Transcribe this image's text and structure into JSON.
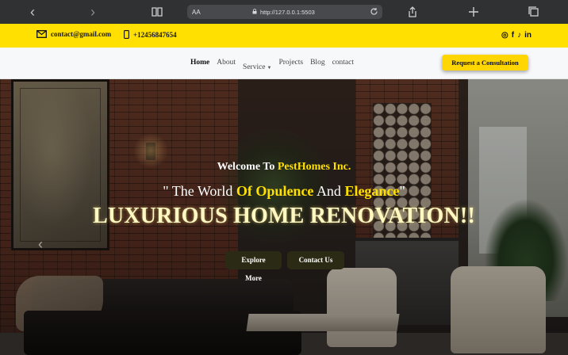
{
  "browser": {
    "url": "http://127.0.0.1:5503",
    "text_size_label": "AA"
  },
  "topbar": {
    "email": "contact@gmail.com",
    "phone": "+12456847654",
    "social_icons": [
      "instagram-icon",
      "facebook-icon",
      "tiktok-icon",
      "linkedin-icon"
    ],
    "social_glyphs": [
      "◎",
      "f",
      "♪",
      "in"
    ]
  },
  "nav": {
    "items": [
      {
        "label": "Home",
        "active": true
      },
      {
        "label": "About"
      },
      {
        "label": "Service",
        "dropdown": true
      },
      {
        "label": "Projects"
      },
      {
        "label": "Blog"
      },
      {
        "label": "contact"
      }
    ],
    "cta": "Request a Consultation"
  },
  "hero": {
    "welcome_prefix": "Welcome To",
    "brand": "PestHomes Inc.",
    "quote_open": "\" The World",
    "quote_hl1": "Of Opulence",
    "quote_mid": "And",
    "quote_hl2": "Elegance",
    "quote_close": "\"",
    "title": "LUXURIOUS HOME RENOVATION!!",
    "primary_button": "Explore More",
    "secondary_button": "Contact Us"
  },
  "colors": {
    "accent_yellow": "#ffe000",
    "button_dark": "#2b2a14",
    "chrome_bg": "#2f3133"
  }
}
